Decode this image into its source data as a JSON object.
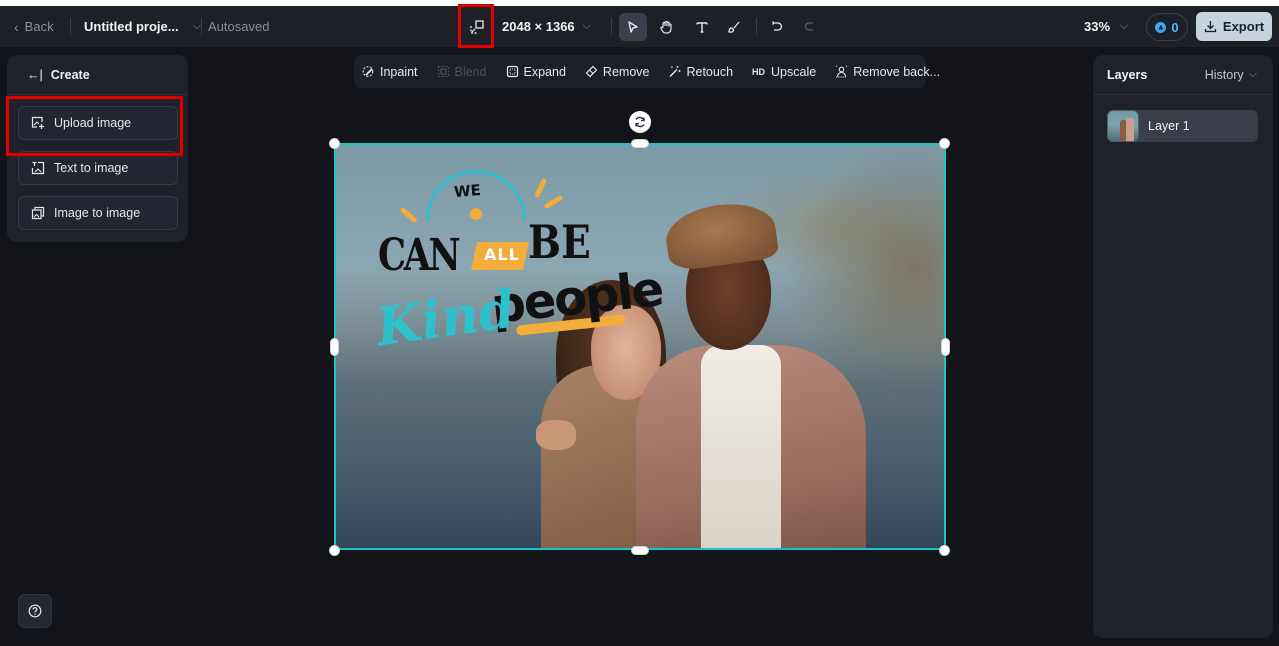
{
  "topbar": {
    "back_label": "Back",
    "project_name": "Untitled proje...",
    "save_status": "Autosaved",
    "canvas_size": "2048 × 1366",
    "zoom_level": "33%",
    "credits": "0",
    "export_label": "Export",
    "tools": [
      {
        "name": "select",
        "icon": "cursor-arrow-icon",
        "active": true
      },
      {
        "name": "hand",
        "icon": "hand-icon",
        "active": false
      },
      {
        "name": "text",
        "icon": "text-t-icon",
        "active": false
      },
      {
        "name": "brush",
        "icon": "brush-icon",
        "active": false
      },
      {
        "name": "undo",
        "icon": "undo-icon",
        "active": false
      },
      {
        "name": "redo",
        "icon": "redo-icon",
        "disabled": true
      }
    ]
  },
  "left_panel": {
    "header": "Create",
    "items": [
      {
        "label": "Upload image",
        "icon": "upload-image-icon"
      },
      {
        "label": "Text to image",
        "icon": "text-to-image-icon"
      },
      {
        "label": "Image to image",
        "icon": "image-to-image-icon"
      }
    ]
  },
  "ai_tools": [
    {
      "label": "Inpaint",
      "icon": "inpaint-icon",
      "disabled": false
    },
    {
      "label": "Blend",
      "icon": "blend-icon",
      "disabled": true
    },
    {
      "label": "Expand",
      "icon": "expand-icon",
      "disabled": false
    },
    {
      "label": "Remove",
      "icon": "eraser-icon",
      "disabled": false
    },
    {
      "label": "Retouch",
      "icon": "magic-wand-icon",
      "disabled": false
    },
    {
      "label": "Upscale",
      "icon": "hd-icon",
      "prefix": "HD",
      "disabled": false
    },
    {
      "label": "Remove back...",
      "icon": "remove-background-icon",
      "disabled": false
    }
  ],
  "canvas": {
    "image_text": {
      "we": "WE",
      "can": "CAN",
      "all": "ALL",
      "be": "BE",
      "kind": "Kind",
      "people": "people"
    },
    "selection_color": "#18c4c8"
  },
  "right_panel": {
    "title": "Layers",
    "history_label": "History",
    "layers": [
      {
        "name": "Layer 1"
      }
    ]
  },
  "colors": {
    "background": "#131419",
    "panel": "#1f222a",
    "topbar": "#1d2027",
    "export_button": "#c5d3dc",
    "highlight": "#e00000",
    "credit_accent": "#3aa8f0"
  }
}
